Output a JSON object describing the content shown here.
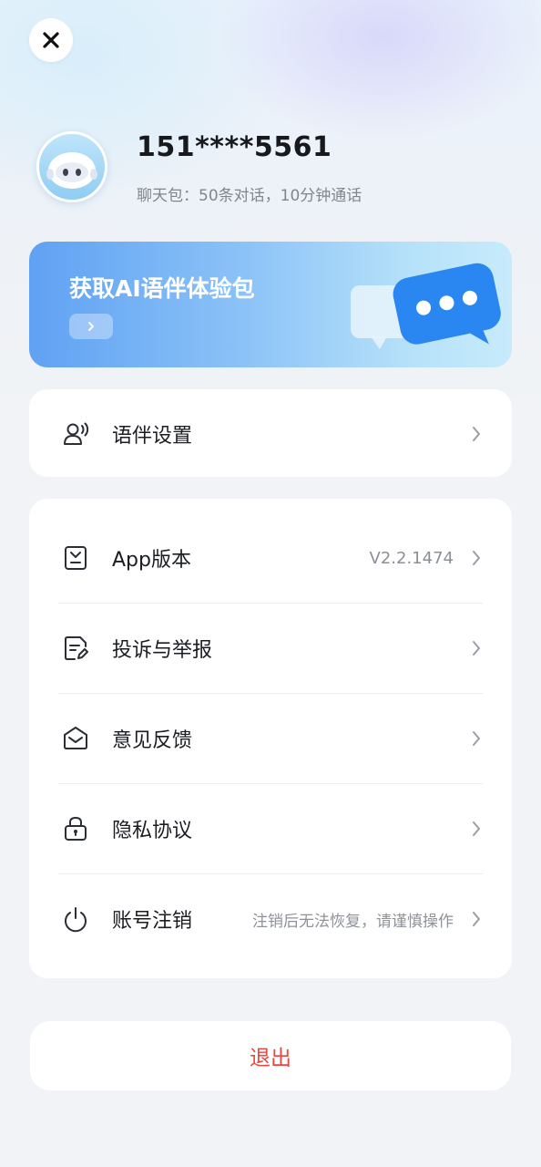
{
  "profile": {
    "phone": "151****5561",
    "package_text": "聊天包：50条对话，10分钟通话"
  },
  "banner": {
    "title": "获取AI语伴体验包"
  },
  "settings_card": {
    "items": [
      {
        "label": "语伴设置",
        "icon": "voice-partner-icon"
      }
    ]
  },
  "menu_card": {
    "items": [
      {
        "label": "App版本",
        "value": "V2.2.1474",
        "icon": "download-icon"
      },
      {
        "label": "投诉与举报",
        "value": "",
        "icon": "report-document-icon"
      },
      {
        "label": "意见反馈",
        "value": "",
        "icon": "feedback-mail-icon"
      },
      {
        "label": "隐私协议",
        "value": "",
        "icon": "lock-icon"
      },
      {
        "label": "账号注销",
        "value": "注销后无法恢复，请谨慎操作",
        "icon": "power-icon"
      }
    ]
  },
  "logout": {
    "label": "退出"
  },
  "colors": {
    "accent": "#5fa1f3",
    "danger": "#e8483f",
    "background": "#f1f3f6"
  }
}
